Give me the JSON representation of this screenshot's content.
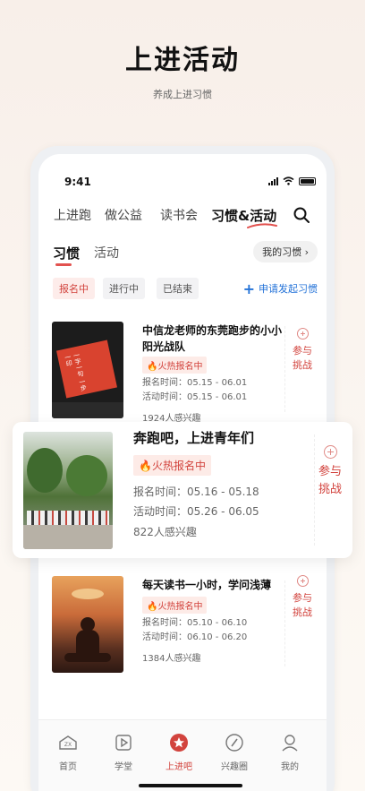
{
  "hero": {
    "title": "上进活动",
    "subtitle": "养成上进习惯"
  },
  "status_bar": {
    "time": "9:41"
  },
  "top_tabs": [
    "上进跑",
    "做公益",
    "读书会",
    "习惯&活动"
  ],
  "sub_tabs": [
    "习惯",
    "活动"
  ],
  "my_habits": "我的习惯 ›",
  "filters": [
    "报名中",
    "进行中",
    "已结束"
  ],
  "apply_label": "申请发起习惯",
  "cards": [
    {
      "title": "中信龙老师的东莞跑步的小小阳光战队",
      "badge": "火热报名中",
      "signup": "报名时间：05.15 - 06.01",
      "activity": "活动时间：05.15 - 06.01",
      "interest": "1924人感兴趣",
      "join": "参与挑战"
    },
    {
      "title": "奔跑吧，上进青年们",
      "badge": "火热报名中",
      "signup": "报名时间：05.16 - 05.18",
      "activity": "活动时间：05.26 - 06.05",
      "interest": "822人感兴趣",
      "join": "参与挑战"
    },
    {
      "title": "每天读书一小时，学问浅薄",
      "badge": "火热报名中",
      "signup": "报名时间：05.10 - 06.10",
      "activity": "活动时间：06.10 - 06.20",
      "interest": "1384人感兴趣",
      "join": "参与挑战"
    }
  ],
  "bottom_nav": [
    "首页",
    "学堂",
    "上进吧",
    "兴趣圈",
    "我的"
  ],
  "book_cover_text": [
    "一字一句",
    "一步一印"
  ],
  "colors": {
    "accent": "#d2433d",
    "link": "#2473d8"
  }
}
